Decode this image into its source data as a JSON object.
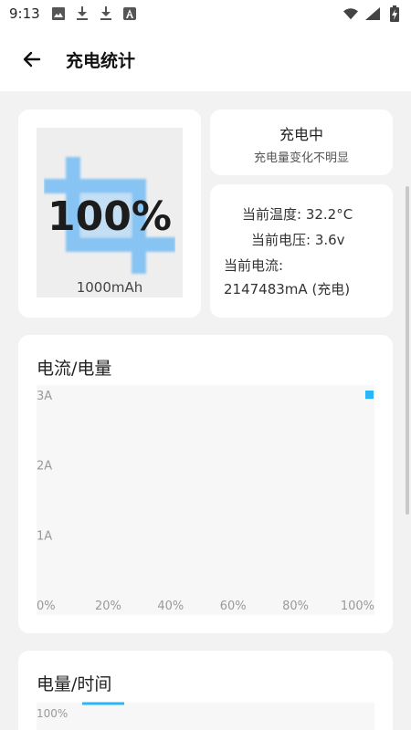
{
  "status_bar": {
    "time": "9:13",
    "left_icons": [
      "image-icon",
      "download-icon",
      "download-icon",
      "font-icon"
    ],
    "right_icons": [
      "wifi-icon",
      "signal-icon",
      "battery-charging-icon"
    ]
  },
  "app_bar": {
    "title": "充电统计",
    "back_icon": "arrow-left-icon"
  },
  "battery": {
    "percent": "100%",
    "capacity": "1000mAh",
    "accent_color": "#64b5f6"
  },
  "charge_status": {
    "title": "充电中",
    "subtitle": "充电量变化不明显"
  },
  "info": {
    "temperature": "当前温度: 32.2°C",
    "voltage": "当前电压: 3.6v",
    "current_label": "当前电流:",
    "current_value": "2147483mA (充电)"
  },
  "chart_current_power": {
    "title": "电流/电量",
    "chart_data": {
      "type": "scatter",
      "x_tick_labels": [
        "0%",
        "20%",
        "40%",
        "60%",
        "80%",
        "100%"
      ],
      "y_tick_labels": [
        "1A",
        "2A",
        "3A"
      ],
      "xlim": [
        0,
        100
      ],
      "ylim": [
        0,
        3
      ],
      "points": [
        {
          "x": 100,
          "y": 3
        }
      ],
      "point_color": "#29b6f6"
    }
  },
  "chart_power_time": {
    "title": "电量/时间",
    "chart_data": {
      "type": "line",
      "y_tick_labels": [
        "100%"
      ],
      "line_color": "#29b6f6"
    }
  }
}
